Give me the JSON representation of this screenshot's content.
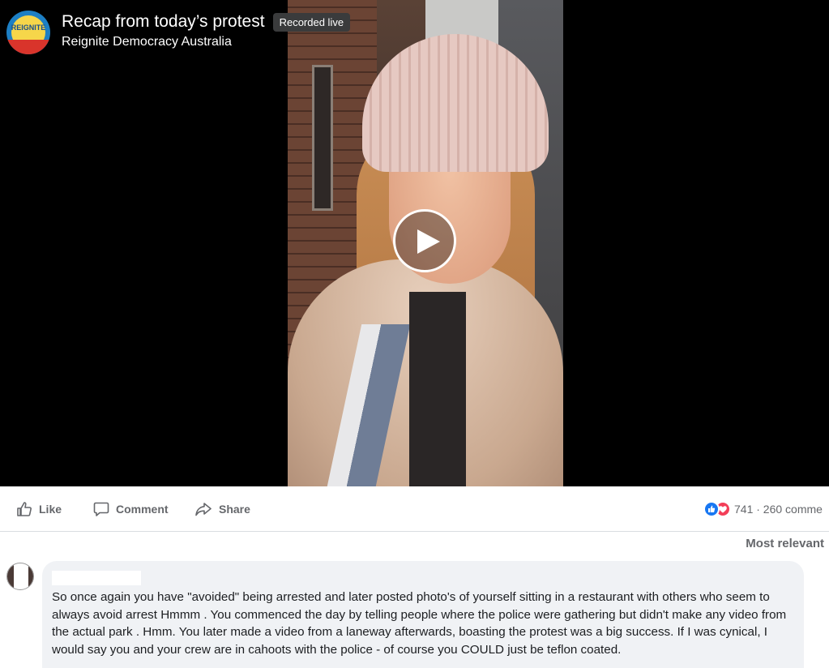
{
  "video": {
    "title": "Recap from today’s protest",
    "badge": "Recorded live",
    "page_name": "Reignite Democracy Australia",
    "logo_text": "REIGNITE"
  },
  "actions": {
    "like": "Like",
    "comment": "Comment",
    "share": "Share"
  },
  "reactions": {
    "summary": "741 · 260 comme"
  },
  "comments": {
    "sort_label": "Most relevant",
    "items": [
      {
        "text": "So once again you have \"avoided\" being arrested and later posted photo's of yourself sitting in a restaurant with others who seem to always avoid arrest Hmmm . You commenced the day by telling people where the police were gathering but didn't make any video from the actual park . Hmm. You later made a video from a laneway afterwards, boasting the protest was a big success. If I was cynical, I would say you and your crew are in cahoots with the police - of course you COULD just be teflon coated."
      }
    ]
  },
  "colors": {
    "accent": "#1877f2",
    "love": "#f33e58",
    "muted_text": "#65676b",
    "bubble": "#f0f2f5"
  },
  "icons": [
    "play-icon",
    "like-icon",
    "comment-icon",
    "share-icon",
    "like-reaction-icon",
    "love-reaction-icon"
  ]
}
